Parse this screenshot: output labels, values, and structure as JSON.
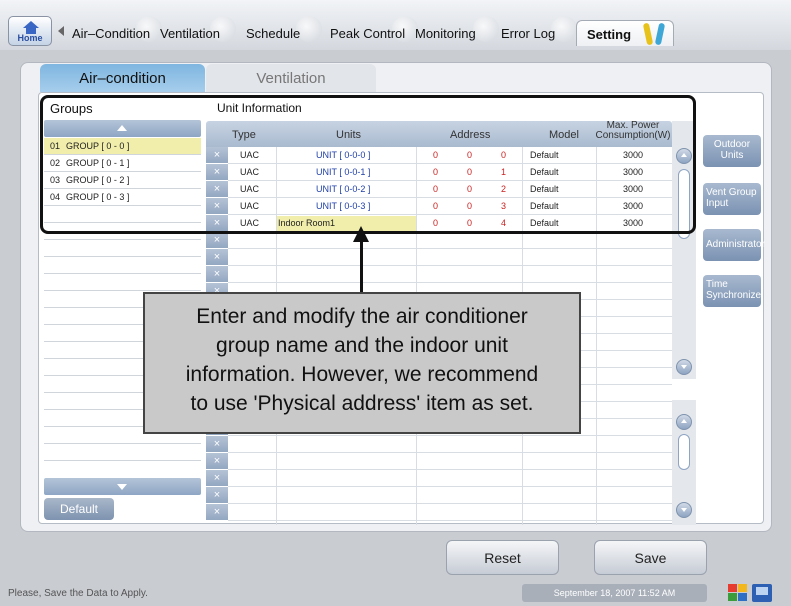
{
  "nav": {
    "home": "Home",
    "tabs": [
      "Air–Condition",
      "Ventilation",
      "Schedule",
      "Peak Control",
      "Monitoring",
      "Error Log",
      "Setting"
    ],
    "active_tab": "Setting"
  },
  "subtabs": {
    "active": "Air–condition",
    "inactive": "Ventilation"
  },
  "groups": {
    "title": "Groups",
    "items": [
      {
        "no": "01",
        "name": "GROUP [ 0 - 0 ]"
      },
      {
        "no": "02",
        "name": "GROUP [ 0 - 1 ]"
      },
      {
        "no": "03",
        "name": "GROUP [ 0 - 2 ]"
      },
      {
        "no": "04",
        "name": "GROUP [ 0 - 3 ]"
      }
    ],
    "default_button": "Default"
  },
  "units": {
    "title": "Unit Information",
    "headers": {
      "type": "Type",
      "units": "Units",
      "address": "Address",
      "model": "Model",
      "max_power_1": "Max. Power",
      "max_power_2": "Consumption(W)"
    },
    "delete_glyph": "×",
    "rows": [
      {
        "type": "UAC",
        "unit": "UNIT [ 0-0-0 ]",
        "a1": "0",
        "a2": "0",
        "a3": "0",
        "model": "Default",
        "power": "3000"
      },
      {
        "type": "UAC",
        "unit": "UNIT [ 0-0-1 ]",
        "a1": "0",
        "a2": "0",
        "a3": "1",
        "model": "Default",
        "power": "3000"
      },
      {
        "type": "UAC",
        "unit": "UNIT [ 0-0-2 ]",
        "a1": "0",
        "a2": "0",
        "a3": "2",
        "model": "Default",
        "power": "3000"
      },
      {
        "type": "UAC",
        "unit": "UNIT [ 0-0-3 ]",
        "a1": "0",
        "a2": "0",
        "a3": "3",
        "model": "Default",
        "power": "3000"
      },
      {
        "type": "UAC",
        "unit": "Indoor Room1",
        "a1": "0",
        "a2": "0",
        "a3": "4",
        "model": "Default",
        "power": "3000"
      }
    ]
  },
  "side_buttons": {
    "outdoor_1": "Outdoor",
    "outdoor_2": "Units",
    "vent_1": "Vent Group",
    "vent_2": "Input",
    "admin": "Administrator",
    "time_1": "Time",
    "time_2": "Synchronize"
  },
  "callout": {
    "line1": "Enter and modify the air conditioner",
    "line2": "group name and the indoor unit",
    "line3": "information.  However, we recommend",
    "line4": "to use 'Physical address' item as set."
  },
  "footer": {
    "reset": "Reset",
    "save": "Save",
    "status": "Please, Save the Data to Apply.",
    "datetime": "September 18, 2007 11:52 AM"
  }
}
